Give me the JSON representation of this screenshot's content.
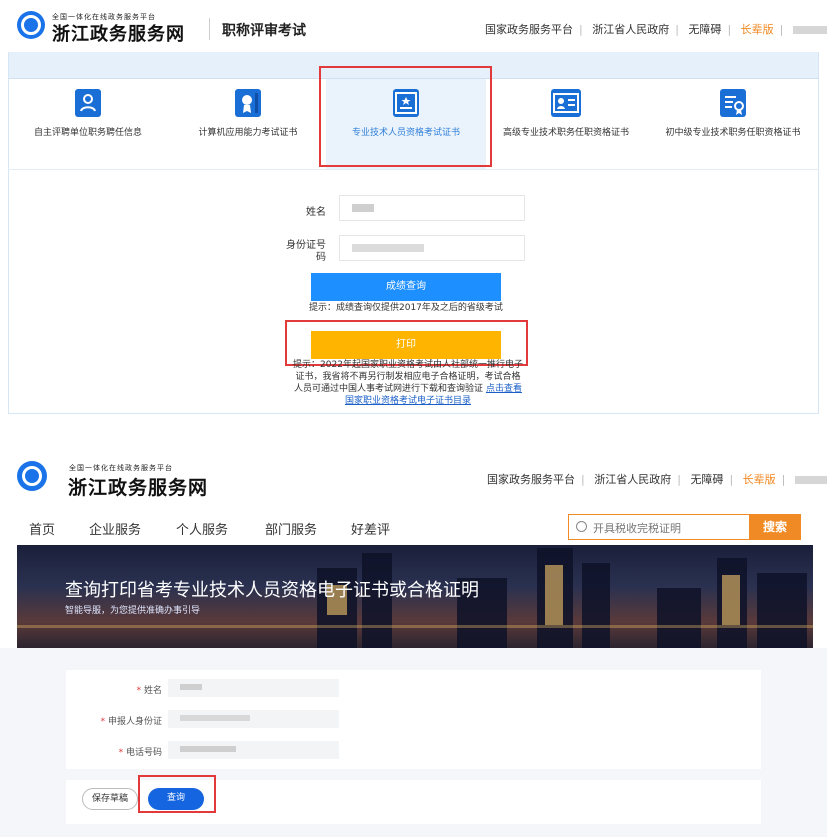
{
  "s1": {
    "logo": {
      "sub": "全国一体化在线政务服务平台",
      "title": "浙江政务服务网"
    },
    "site_title": "职称评审考试",
    "toplinks": [
      "国家政务服务平台",
      "浙江省人民政府",
      "无障碍",
      "长辈版"
    ],
    "tabs": [
      {
        "label": "自主评聘单位职务聘任信息",
        "icon": "person-card-icon"
      },
      {
        "label": "计算机应用能力考试证书",
        "icon": "medal-icon"
      },
      {
        "label": "专业技术人员资格考试证书",
        "icon": "certificate-star-icon",
        "active": true
      },
      {
        "label": "高级专业技术职务任职资格证书",
        "icon": "id-card-icon"
      },
      {
        "label": "初中级专业技术职务任职资格证书",
        "icon": "document-badge-icon"
      }
    ],
    "form": {
      "name_label": "姓名",
      "id_label_1": "身份证号",
      "id_label_2": "码",
      "query_button": "成绩查询",
      "tip": "提示：成绩查询仅提供2017年及之后的省级考试",
      "print_button": "打印",
      "notice_1": "提示：2022年起国家职业资格考试由人社部统一推行电子",
      "notice_2": "证书，我省将不再另行制发相应电子合格证明，考试合格",
      "notice_3": "人员可通过中国人事考试网进行下载和查询验证",
      "notice_link_1": "点击查看",
      "notice_link_2": "国家职业资格考试电子证书目录"
    }
  },
  "s2": {
    "logo": {
      "sub": "全国一体化在线政务服务平台",
      "title": "浙江政务服务网"
    },
    "toplinks": [
      "国家政务服务平台",
      "浙江省人民政府",
      "无障碍",
      "长辈版"
    ],
    "nav": [
      "首页",
      "企业服务",
      "个人服务",
      "部门服务",
      "好差评"
    ],
    "search_placeholder": "开具税收完税证明",
    "search_button": "搜索",
    "banner_title": "查询打印省考专业技术人员资格电子证书或合格证明",
    "banner_sub": "智能导服，为您提供准确办事引导",
    "fields": [
      {
        "label": "姓名"
      },
      {
        "label": "申报人身份证"
      },
      {
        "label": "电话号码"
      }
    ],
    "save_button": "保存草稿",
    "query_button": "查询"
  },
  "colors": {
    "brand_blue": "#1a73e8",
    "orange": "#f08a24",
    "print_yellow": "#ffb400",
    "query_blue": "#1e8fff",
    "highlight_red": "#e23a3a"
  }
}
